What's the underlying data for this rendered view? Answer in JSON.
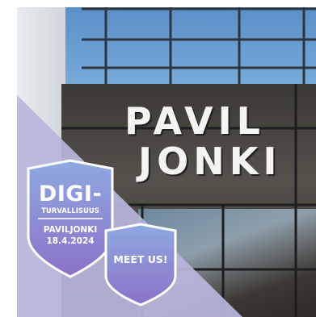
{
  "sign": {
    "line1": "PAVIL",
    "line2": "JONKI"
  },
  "badge_digi": {
    "title": "DIGI-",
    "subtitle": "TURVALLISUUS",
    "venue": "PAVILJONKI",
    "date": "18.4.2024"
  },
  "badge_meet": {
    "label": "MEET US!"
  },
  "colors": {
    "overlay": "#b8b6dc",
    "badge_top": "#8fa9e0",
    "badge_bottom": "#8a72c8"
  }
}
